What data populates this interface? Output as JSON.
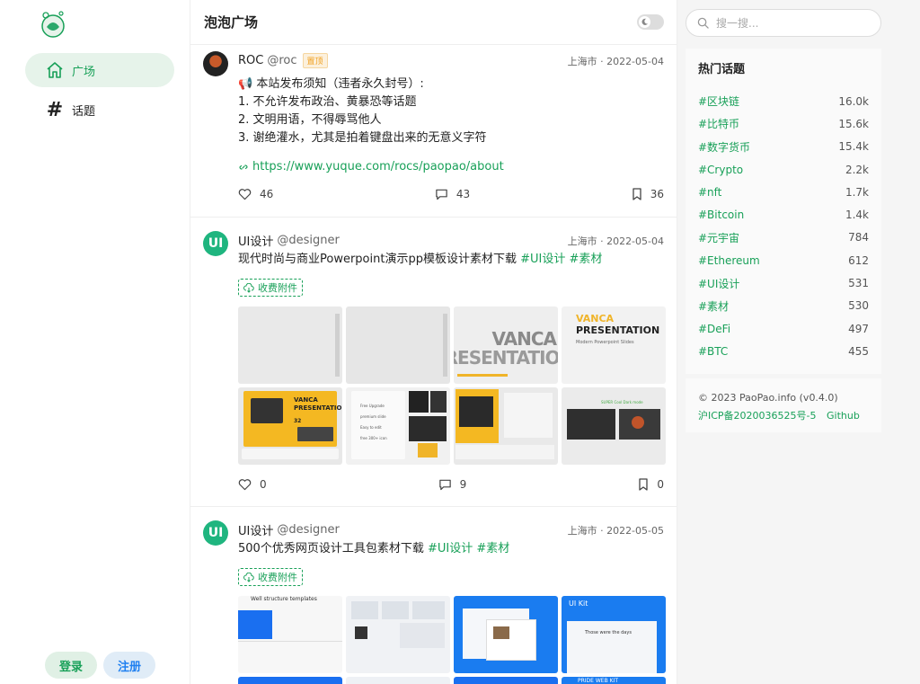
{
  "sidebar": {
    "nav": [
      {
        "label": "广场",
        "icon": "home-icon",
        "active": true
      },
      {
        "label": "话题",
        "icon": "hash-icon",
        "active": false
      }
    ],
    "login_label": "登录",
    "register_label": "注册"
  },
  "main": {
    "title": "泡泡广场",
    "posts": [
      {
        "name": "ROC",
        "handle": "@roc",
        "badge": "置顶",
        "meta": "上海市 · 2022-05-04",
        "lines": [
          "📢 本站发布须知（违者永久封号）:",
          "1. 不允许发布政治、黄暴恐等话题",
          "2. 文明用语，不得辱骂他人",
          "3. 谢绝灌水，尤其是拍着键盘出来的无意义字符"
        ],
        "link": "https://www.yuque.com/rocs/paopao/about",
        "likes": "46",
        "comments": "43",
        "collects": "36"
      },
      {
        "name": "UI设计",
        "handle": "@designer",
        "meta": "上海市 · 2022-05-04",
        "text": "现代时尚与商业Powerpoint演示pp模板设计素材下载",
        "tags": [
          "#UI设计",
          "#素材"
        ],
        "attachment": "收费附件",
        "thumb_text": {
          "vanca_big": "VANCA",
          "presentation_big": "PRESENTATION",
          "vanca": "VANCA",
          "presentation": "PRESENTATION",
          "subtitle": "Modern Powerpoint Slides",
          "card_vanca": "VANCA",
          "card_presentation": "PRESENTATION",
          "card_number": "32",
          "premium_1": "Free Upgrade",
          "premium_2": "premium slide",
          "premium_3": "Easy to edit",
          "premium_4": "free 300+ icon",
          "super_cool": "SUPER Cool Dark mode"
        },
        "likes": "0",
        "comments": "9",
        "collects": "0"
      },
      {
        "name": "UI设计",
        "handle": "@designer",
        "meta": "上海市 · 2022-05-05",
        "text": "500个优秀网页设计工具包素材下载",
        "tags": [
          "#UI设计",
          "#素材"
        ],
        "attachment": "收费附件",
        "thumb_text": {
          "well_structure": "Well structure templates",
          "ui_kit": "UI Kit",
          "those_were": "Those were the days",
          "pride_web": "PRIDE WEB KIT"
        }
      }
    ]
  },
  "right": {
    "search_placeholder": "搜一搜...",
    "hot_title": "热门话题",
    "topics": [
      {
        "name": "#区块链",
        "count": "16.0k"
      },
      {
        "name": "#比特币",
        "count": "15.6k"
      },
      {
        "name": "#数字货币",
        "count": "15.4k"
      },
      {
        "name": "#Crypto",
        "count": "2.2k"
      },
      {
        "name": "#nft",
        "count": "1.7k"
      },
      {
        "name": "#Bitcoin",
        "count": "1.4k"
      },
      {
        "name": "#元宇宙",
        "count": "784"
      },
      {
        "name": "#Ethereum",
        "count": "612"
      },
      {
        "name": "#UI设计",
        "count": "531"
      },
      {
        "name": "#素材",
        "count": "530"
      },
      {
        "name": "#DeFi",
        "count": "497"
      },
      {
        "name": "#BTC",
        "count": "455"
      }
    ],
    "copyright": "© 2023 PaoPao.info (v0.4.0)",
    "icp": "沪ICP备2020036525号-5",
    "github": "Github"
  },
  "colors": {
    "accent": "#18a058",
    "info": "#2080f0",
    "warning": "#f0a020"
  }
}
